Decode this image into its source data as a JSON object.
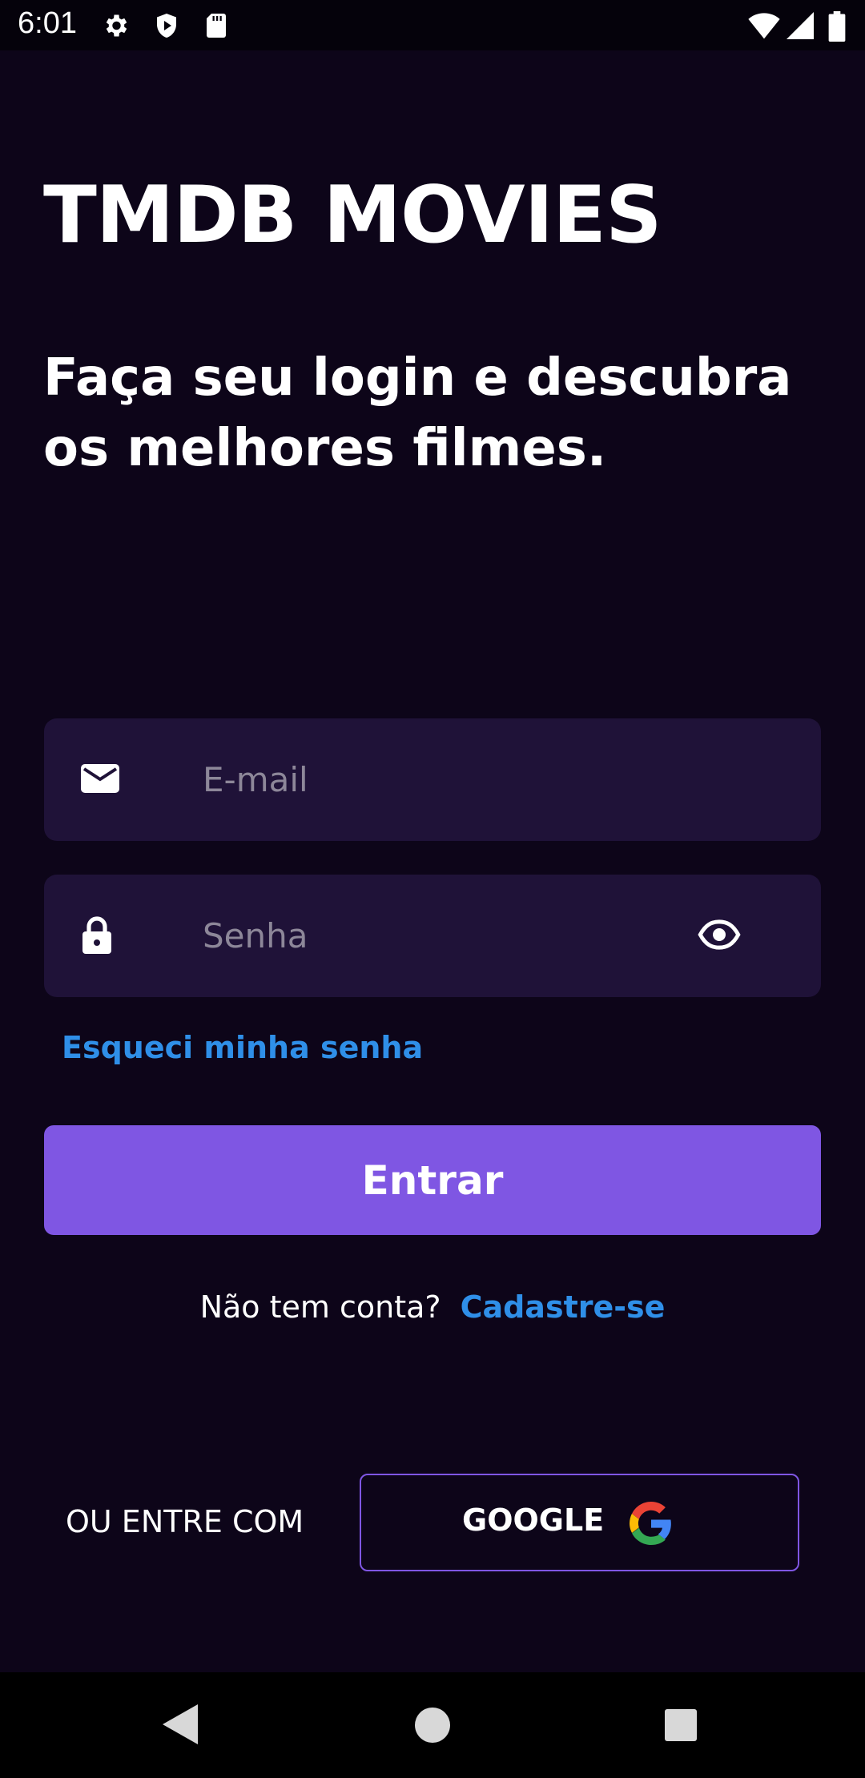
{
  "status_bar": {
    "time": "6:01",
    "icons": [
      "settings-icon",
      "shield-icon",
      "sd-card-icon",
      "wifi-icon",
      "signal-icon",
      "battery-icon"
    ]
  },
  "app_title": "TMDB MOVIES",
  "subtitle": "Faça seu login e descubra os melhores filmes.",
  "email_field": {
    "placeholder": "E-mail",
    "icon": "mail-icon"
  },
  "password_field": {
    "placeholder": "Senha",
    "icon": "lock-icon",
    "toggle_icon": "eye-icon"
  },
  "forgot_password": "Esqueci minha senha",
  "login_button": "Entrar",
  "signup": {
    "text": "Não tem conta?",
    "link": "Cadastre-se"
  },
  "social_login": {
    "label": "OU ENTRE COM",
    "google_button": "GOOGLE",
    "icon": "google-icon"
  },
  "nav_bar": {
    "buttons": [
      "back-icon",
      "home-icon",
      "recents-icon"
    ]
  },
  "colors": {
    "background": "#0d0519",
    "field_background": "#1f1238",
    "accent": "#7f56e3",
    "link": "#2f8fe8",
    "placeholder": "#8d8799"
  }
}
